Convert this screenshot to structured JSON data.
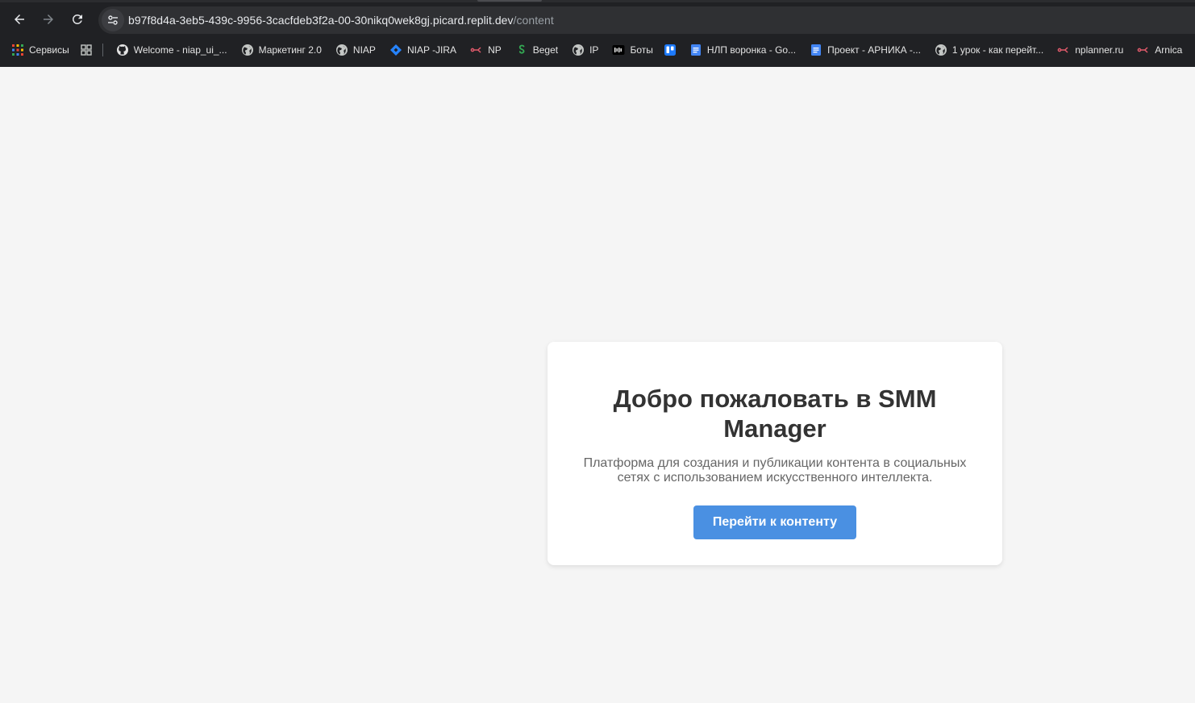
{
  "browser": {
    "url_host": "b97f8d4a-3eb5-439c-9956-3cacfdeb3f2a-00-30nikq0wek8gj.picard.replit.dev",
    "url_path": "/content",
    "bookmarks": [
      {
        "label": "Сервисы",
        "icon": "apps-grid-icon"
      },
      {
        "label": "",
        "icon": "tab-groups-icon"
      },
      {
        "label": "Welcome - niap_ui_...",
        "icon": "github-icon"
      },
      {
        "label": "Маркетинг 2.0",
        "icon": "globe-icon"
      },
      {
        "label": "NIAP",
        "icon": "globe-icon"
      },
      {
        "label": "NIAP -JIRA",
        "icon": "jira-icon"
      },
      {
        "label": "NP",
        "icon": "link-icon"
      },
      {
        "label": "Beget",
        "icon": "beget-icon"
      },
      {
        "label": "IP",
        "icon": "globe-icon"
      },
      {
        "label": "Боты",
        "icon": "bots-icon"
      },
      {
        "label": "",
        "icon": "trello-icon"
      },
      {
        "label": "НЛП воронка - Go...",
        "icon": "docs-icon"
      },
      {
        "label": "Проект - АРНИКА -...",
        "icon": "docs-icon"
      },
      {
        "label": "1 урок - как перейт...",
        "icon": "globe-icon"
      },
      {
        "label": "nplanner.ru",
        "icon": "link-icon"
      },
      {
        "label": "Arnica",
        "icon": "link-icon"
      }
    ],
    "colors": {
      "chrome_bg": "#202124",
      "omnibox_bg": "#2f3033"
    }
  },
  "page": {
    "title": "Добро пожаловать в SMM Manager",
    "description": "Платформа для создания и публикации контента в социальных сетях с использованием искусственного интеллекта.",
    "button_label": "Перейти к контенту",
    "colors": {
      "background": "#f5f5f5",
      "card": "#ffffff",
      "accent": "#4a90e2",
      "title": "#333333",
      "text": "#666666"
    }
  }
}
